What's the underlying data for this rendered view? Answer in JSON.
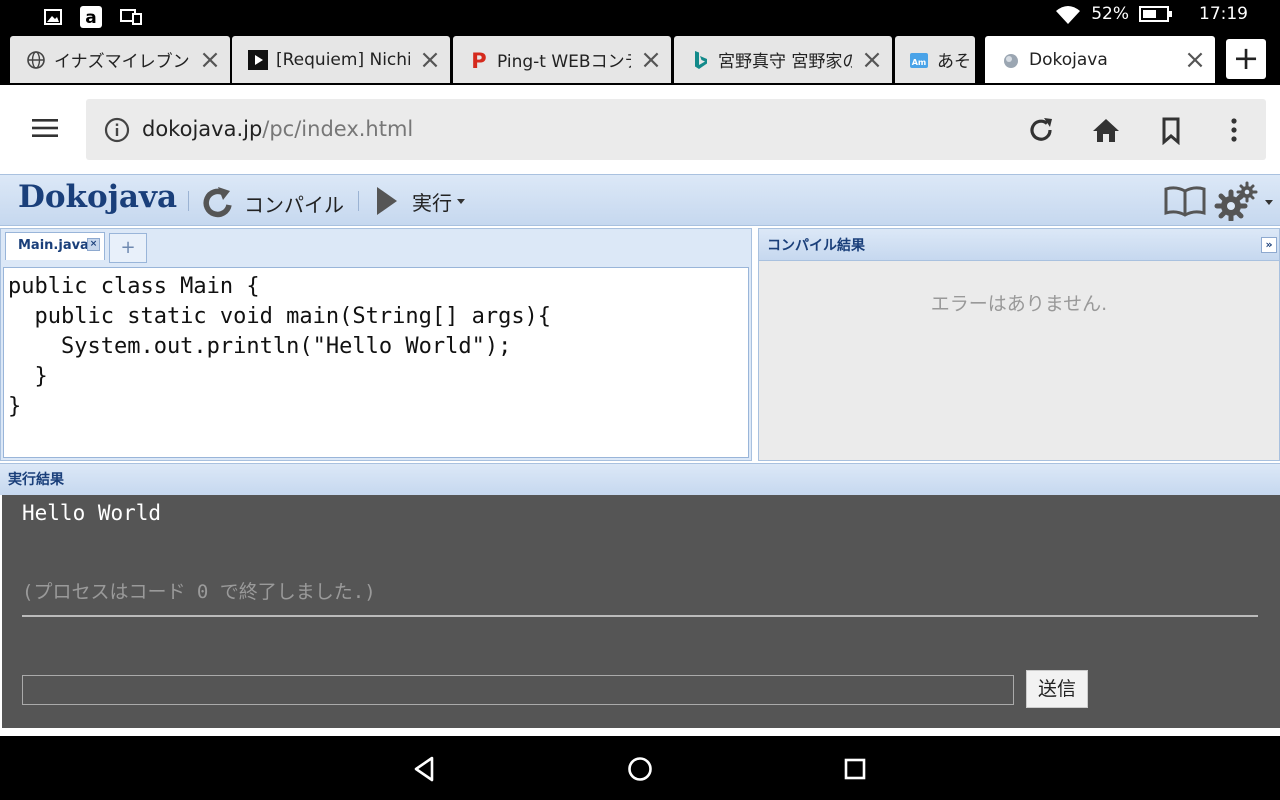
{
  "status_bar": {
    "battery": "52%",
    "time": "17:19"
  },
  "browser": {
    "tabs": [
      {
        "title": "イナズマイレブン",
        "favicon": "globe-icon"
      },
      {
        "title": "[Requiem] Nichijo",
        "favicon": "play-icon"
      },
      {
        "title": "Ping-t WEBコンテ",
        "favicon": "ping-t-icon"
      },
      {
        "title": "宮野真守 宮野家の",
        "favicon": "bing-icon"
      },
      {
        "title": "あそ",
        "favicon": "ameba-icon"
      },
      {
        "title": "Dokojava",
        "favicon": "dokojava-icon"
      }
    ],
    "new_tab_label": "+",
    "url_host": "dokojava.jp",
    "url_path": "/pc/index.html"
  },
  "app": {
    "logo": "Dokojava",
    "compile_label": "コンパイル",
    "run_label": "実行",
    "file_tab": "Main.java",
    "add_tab": "+",
    "code_lines": [
      "public class Main {",
      "  public static void main(String[] args){",
      "    System.out.println(\"Hello World\");",
      "  }",
      "}"
    ],
    "compile_panel_title": "コンパイル結果",
    "compile_message": "エラーはありません.",
    "run_panel_title": "実行結果",
    "console_output": "Hello World",
    "console_exit": "(プロセスはコード 0 で終了しました.)",
    "send_label": "送信"
  },
  "colors": {
    "accent": "#1a3f7a",
    "header_bg": "#dce8f7",
    "console_bg": "#555555"
  }
}
